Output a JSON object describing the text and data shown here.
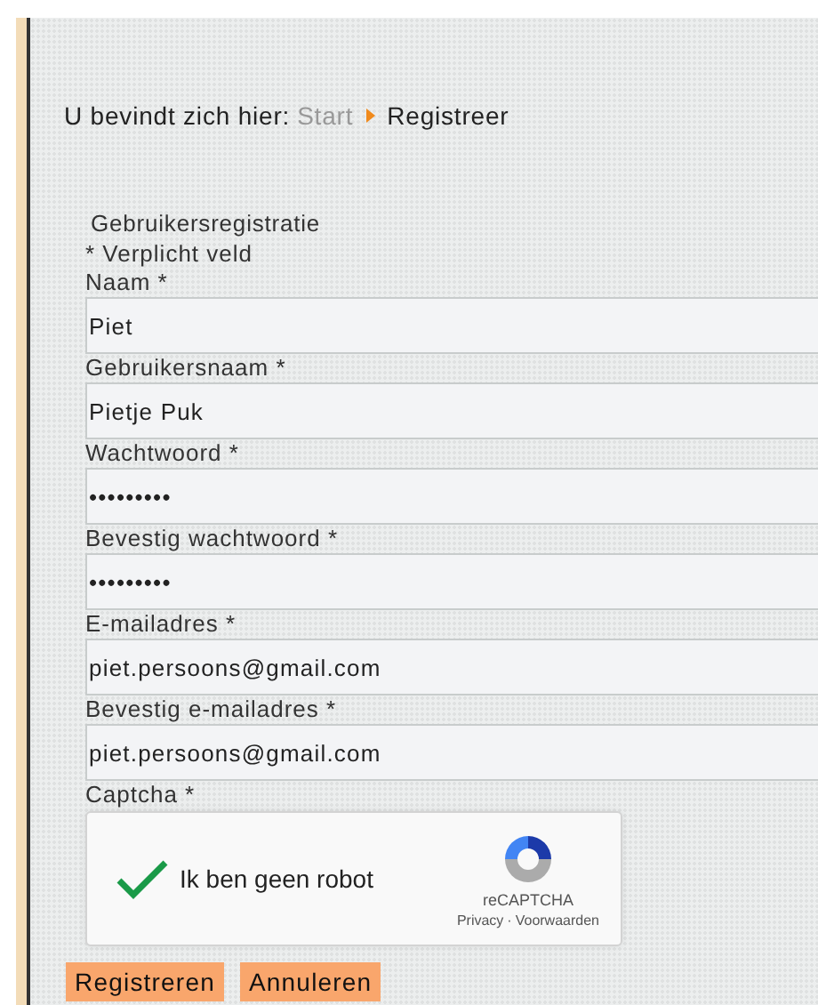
{
  "breadcrumb": {
    "prefix": "U bevindt zich hier:",
    "items": [
      {
        "label": "Start",
        "current": false
      },
      {
        "label": "Registreer",
        "current": true
      }
    ]
  },
  "form": {
    "title": "Gebruikersregistratie",
    "required_note": "* Verplicht veld",
    "fields": [
      {
        "label": "Naam *",
        "value": "Piet"
      },
      {
        "label": "Gebruikersnaam *",
        "value": "Pietje Puk"
      },
      {
        "label": "Wachtwoord *",
        "value": "•••••••••"
      },
      {
        "label": "Bevestig wachtwoord *",
        "value": "•••••••••"
      },
      {
        "label": "E-mailadres *",
        "value": "piet.persoons@gmail.com"
      },
      {
        "label": "Bevestig e-mailadres *",
        "value": "piet.persoons@gmail.com"
      }
    ],
    "captcha": {
      "label": "Captcha *",
      "text": "Ik ben geen robot",
      "checked": true,
      "brand": "reCAPTCHA",
      "links": [
        "Privacy",
        "Voorwaarden"
      ],
      "link_separator": "·"
    },
    "buttons": [
      "Registreren",
      "Annuleren"
    ]
  }
}
